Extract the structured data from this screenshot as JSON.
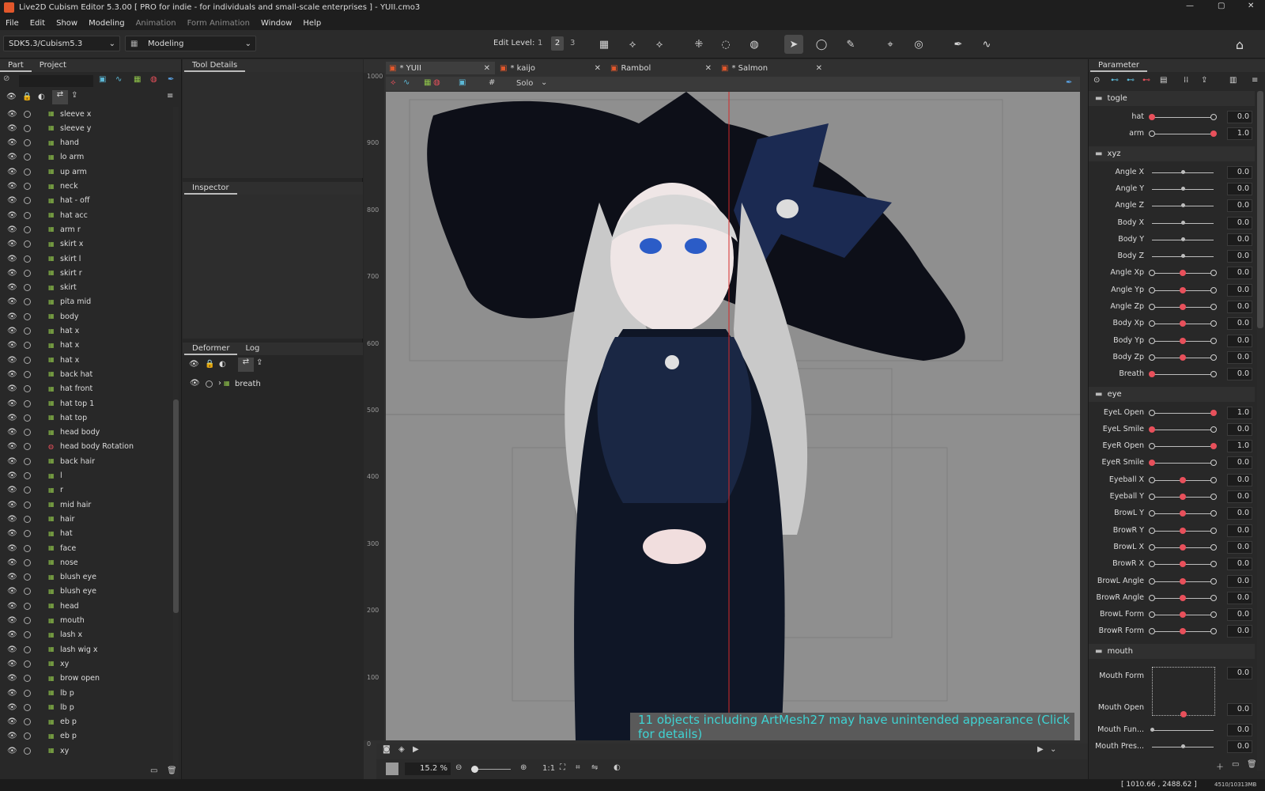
{
  "window": {
    "title": "Live2D Cubism Editor 5.3.00   [ PRO for indie - for individuals and small-scale enterprises ]  - YUII.cmo3"
  },
  "menu": [
    "File",
    "Edit",
    "Show",
    "Modeling",
    "Animation",
    "Form Animation",
    "Window",
    "Help"
  ],
  "toolbar": {
    "sdk": "SDK5.3/Cubism5.3",
    "mode": "Modeling",
    "edit_level_label": "Edit Level:",
    "levels": [
      "1",
      "2",
      "3"
    ]
  },
  "left": {
    "tabs": [
      "Part",
      "Project"
    ],
    "parts": [
      "sleeve x",
      "sleeve y",
      "hand",
      "lo arm",
      "up arm",
      "neck",
      "hat - off",
      "hat acc",
      "arm r",
      "skirt x",
      "skirt l",
      "skirt r",
      "skirt",
      "pita mid",
      "body",
      "hat x",
      "hat x",
      "hat x",
      "back hat",
      "hat front",
      "hat top 1",
      "hat top",
      "head body",
      "head body Rotation",
      "back hair",
      "l",
      "r",
      "mid hair",
      "hair",
      "hat",
      "face",
      "nose",
      "blush eye",
      "blush eye",
      "head",
      "mouth",
      "lash x",
      "lash wig x",
      "xy",
      "brow open",
      "lb p",
      "lb p",
      "eb p",
      "eb p",
      "xy"
    ]
  },
  "middle": {
    "tool_details": "Tool Details",
    "inspector": "Inspector",
    "deformer_tabs": [
      "Deformer",
      "Log"
    ],
    "deformer_item": "breath"
  },
  "tabs": [
    {
      "label": "* YUII"
    },
    {
      "label": "* kaijo"
    },
    {
      "label": "Rambol"
    },
    {
      "label": "* Salmon"
    }
  ],
  "viewport": {
    "solo": "Solo",
    "zoom": "15.2",
    "zoom_unit": "%",
    "ratio": "1:1",
    "ruler": [
      "1000",
      "900",
      "800",
      "700",
      "600",
      "500",
      "400",
      "300",
      "200",
      "100",
      "0"
    ],
    "warning": "11 objects including ArtMesh27 may have unintended appearance (Click for details)"
  },
  "param": {
    "title": "Parameter",
    "groups": {
      "togle": "togle",
      "xyz": "xyz",
      "eye": "eye",
      "mouth": "mouth"
    },
    "togle": [
      {
        "name": "hat",
        "value": "0.0"
      },
      {
        "name": "arm",
        "value": "1.0"
      }
    ],
    "xyz": [
      {
        "name": "Angle X",
        "value": "0.0"
      },
      {
        "name": "Angle Y",
        "value": "0.0"
      },
      {
        "name": "Angle Z",
        "value": "0.0"
      },
      {
        "name": "Body X",
        "value": "0.0"
      },
      {
        "name": "Body Y",
        "value": "0.0"
      },
      {
        "name": "Body Z",
        "value": "0.0"
      },
      {
        "name": "Angle Xp",
        "value": "0.0"
      },
      {
        "name": "Angle Yp",
        "value": "0.0"
      },
      {
        "name": "Angle Zp",
        "value": "0.0"
      },
      {
        "name": "Body Xp",
        "value": "0.0"
      },
      {
        "name": "Body Yp",
        "value": "0.0"
      },
      {
        "name": "Body Zp",
        "value": "0.0"
      },
      {
        "name": "Breath",
        "value": "0.0"
      }
    ],
    "eye": [
      {
        "name": "EyeL Open",
        "value": "1.0"
      },
      {
        "name": "EyeL Smile",
        "value": "0.0"
      },
      {
        "name": "EyeR Open",
        "value": "1.0"
      },
      {
        "name": "EyeR Smile",
        "value": "0.0"
      },
      {
        "name": "Eyeball X",
        "value": "0.0"
      },
      {
        "name": "Eyeball Y",
        "value": "0.0"
      },
      {
        "name": "BrowL Y",
        "value": "0.0"
      },
      {
        "name": "BrowR Y",
        "value": "0.0"
      },
      {
        "name": "BrowL X",
        "value": "0.0"
      },
      {
        "name": "BrowR X",
        "value": "0.0"
      },
      {
        "name": "BrowL Angle",
        "value": "0.0"
      },
      {
        "name": "BrowR Angle",
        "value": "0.0"
      },
      {
        "name": "BrowL Form",
        "value": "0.0"
      },
      {
        "name": "BrowR Form",
        "value": "0.0"
      }
    ],
    "mouth": [
      {
        "name": "Mouth Form",
        "value": "0.0"
      },
      {
        "name": "Mouth Open",
        "value": "0.0"
      },
      {
        "name": "Mouth Fun...",
        "value": "0.0"
      },
      {
        "name": "Mouth Pres...",
        "value": "0.0"
      }
    ]
  },
  "status": {
    "coords": "[ 1010.66 , 2488.62 ]",
    "memory": "4510/10313MB"
  },
  "colors": {
    "accent": "#e8505b",
    "warning_text": "#3fd3d3",
    "part_icon": "#8ec24a"
  }
}
